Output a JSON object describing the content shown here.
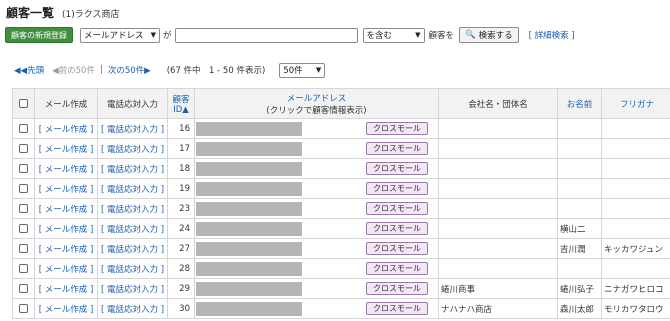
{
  "page": {
    "title": "顧客一覧",
    "subtitle": "(1)ラクス商店"
  },
  "search": {
    "new_button": "顧客の新規登録",
    "field_select": "メールアドレス",
    "ga": "が",
    "query_value": "",
    "condition_select": "を含む",
    "target_text": "顧客を",
    "search_button": "検索する",
    "advanced_link": "[ 詳細検索 ]"
  },
  "pager": {
    "first": "先頭",
    "prev": "前の50件",
    "divider": "|",
    "next": "次の50件",
    "summary": "(67 件中　1 - 50 件表示)",
    "per_page": "50件"
  },
  "table": {
    "headers": {
      "mail": "メール作成",
      "phone": "電話応対入力",
      "id_line1": "顧客",
      "id_line2": "ID",
      "email_line1": "メールアドレス",
      "email_line2": "(クリックで顧客情報表示)",
      "company": "会社名・団体名",
      "name": "お名前",
      "kana": "フリガナ"
    },
    "rows": [
      {
        "mail": "[ メール作成 ]",
        "phone": "[ 電話応対入力 ]",
        "id": "16",
        "badge": "クロスモール",
        "company": "",
        "name": "",
        "kana": ""
      },
      {
        "mail": "[ メール作成 ]",
        "phone": "[ 電話応対入力 ]",
        "id": "17",
        "badge": "クロスモール",
        "company": "",
        "name": "",
        "kana": ""
      },
      {
        "mail": "[ メール作成 ]",
        "phone": "[ 電話応対入力 ]",
        "id": "18",
        "badge": "クロスモール",
        "company": "",
        "name": "",
        "kana": ""
      },
      {
        "mail": "[ メール作成 ]",
        "phone": "[ 電話応対入力 ]",
        "id": "19",
        "badge": "クロスモール",
        "company": "",
        "name": "",
        "kana": ""
      },
      {
        "mail": "[ メール作成 ]",
        "phone": "[ 電話応対入力 ]",
        "id": "23",
        "badge": "クロスモール",
        "company": "",
        "name": "",
        "kana": ""
      },
      {
        "mail": "[ メール作成 ]",
        "phone": "[ 電話応対入力 ]",
        "id": "24",
        "badge": "クロスモール",
        "company": "",
        "name": "横山二",
        "kana": ""
      },
      {
        "mail": "[ メール作成 ]",
        "phone": "[ 電話応対入力 ]",
        "id": "27",
        "badge": "クロスモール",
        "company": "",
        "name": "吉川潤",
        "kana": "キッカワジュン"
      },
      {
        "mail": "[ メール作成 ]",
        "phone": "[ 電話応対入力 ]",
        "id": "28",
        "badge": "クロスモール",
        "company": "",
        "name": "",
        "kana": ""
      },
      {
        "mail": "[ メール作成 ]",
        "phone": "[ 電話応対入力 ]",
        "id": "29",
        "badge": "クロスモール",
        "company": "蜷川商事",
        "name": "蜷川弘子",
        "kana": "ニナガワヒロコ"
      },
      {
        "mail": "[ メール作成 ]",
        "phone": "[ 電話応対入力 ]",
        "id": "30",
        "badge": "クロスモール",
        "company": "ナハナハ商店",
        "name": "森川太郎",
        "kana": "モリカワタロウ"
      }
    ]
  }
}
